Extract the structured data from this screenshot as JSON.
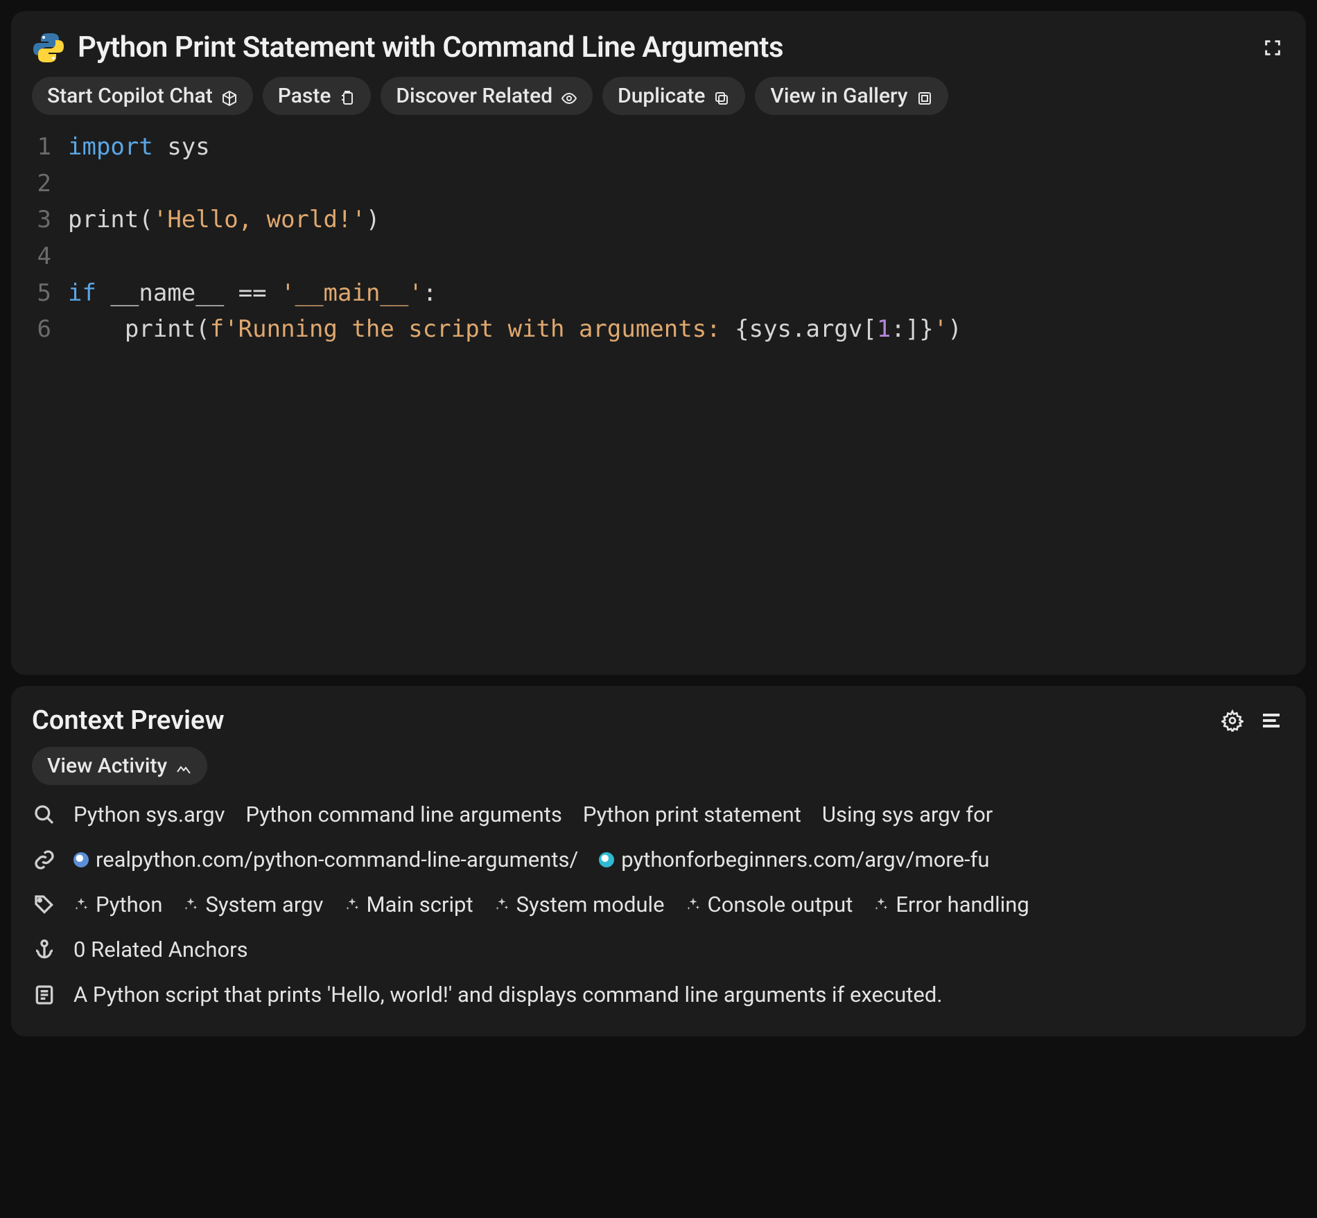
{
  "editor": {
    "title": "Python Print Statement with Command Line Arguments",
    "actions": [
      {
        "label": "Start Copilot Chat",
        "icon": "cube"
      },
      {
        "label": "Paste",
        "icon": "paste"
      },
      {
        "label": "Discover Related",
        "icon": "eye"
      },
      {
        "label": "Duplicate",
        "icon": "duplicate"
      },
      {
        "label": "View in Gallery",
        "icon": "gallery"
      }
    ],
    "code_lines": [
      {
        "n": 1,
        "tokens": [
          [
            "kw",
            "import"
          ],
          [
            "sp",
            " "
          ],
          [
            "id",
            "sys"
          ]
        ]
      },
      {
        "n": 2,
        "tokens": []
      },
      {
        "n": 3,
        "tokens": [
          [
            "id",
            "print"
          ],
          [
            "punc",
            "("
          ],
          [
            "str",
            "'Hello, world!'"
          ],
          [
            "punc",
            ")"
          ]
        ]
      },
      {
        "n": 4,
        "tokens": []
      },
      {
        "n": 5,
        "tokens": [
          [
            "kw",
            "if"
          ],
          [
            "sp",
            " "
          ],
          [
            "id",
            "__name__"
          ],
          [
            "sp",
            " "
          ],
          [
            "op",
            "=="
          ],
          [
            "sp",
            " "
          ],
          [
            "str",
            "'__main__'"
          ],
          [
            "punc",
            ":"
          ]
        ]
      },
      {
        "n": 6,
        "tokens": [
          [
            "sp",
            "    "
          ],
          [
            "id",
            "print"
          ],
          [
            "punc",
            "("
          ],
          [
            "str",
            "f'Running the script with arguments: "
          ],
          [
            "fbrace",
            "{"
          ],
          [
            "id",
            "sys.argv"
          ],
          [
            "punc",
            "["
          ],
          [
            "num",
            "1"
          ],
          [
            "punc",
            ":]"
          ],
          [
            "fbrace",
            "}"
          ],
          [
            "str",
            "'"
          ],
          [
            "punc",
            ")"
          ]
        ]
      }
    ]
  },
  "context": {
    "title": "Context Preview",
    "view_activity_label": "View Activity",
    "search_terms": [
      "Python sys.argv",
      "Python command line arguments",
      "Python print statement",
      "Using sys argv for"
    ],
    "links": [
      {
        "favicon": "blue",
        "text": "realpython.com/python-command-line-arguments/"
      },
      {
        "favicon": "cyan",
        "text": "pythonforbeginners.com/argv/more-fu"
      }
    ],
    "tags": [
      "Python",
      "System argv",
      "Main script",
      "System module",
      "Console output",
      "Error handling"
    ],
    "anchors_label": "0 Related Anchors",
    "summary": "A Python script that prints 'Hello, world!' and displays command line arguments if executed."
  }
}
